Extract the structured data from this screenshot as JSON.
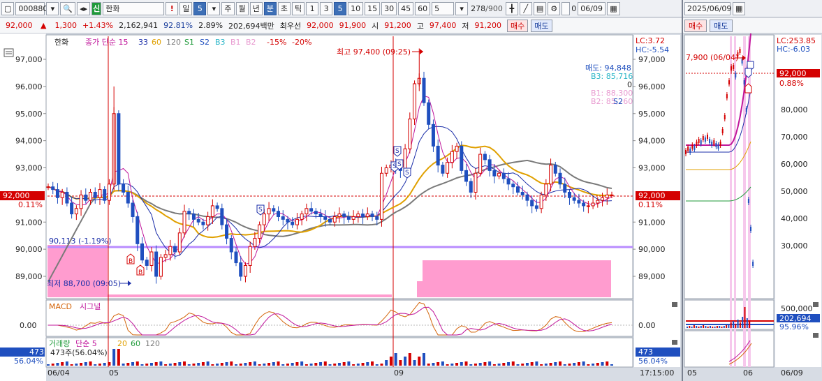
{
  "toolbar": {
    "code": "000880",
    "name": "한화",
    "alert": "!",
    "period_day": "일",
    "period_num": "5",
    "periods": [
      "주",
      "월",
      "년",
      "분",
      "초",
      "틱"
    ],
    "selected_period": "분",
    "minutes": [
      "1",
      "3",
      "5",
      "10",
      "15",
      "30",
      "45",
      "60"
    ],
    "selected_minute": "5",
    "count": "5",
    "bar_count": "278",
    "bar_total": "/900",
    "date": "06/09",
    "checkbox_value": "0"
  },
  "quote": {
    "price": "92,000",
    "arrow": "▲",
    "change": "1,300",
    "change_pct": "+1.43%",
    "volume": "2,162,941",
    "vol_ratio": "92.81%",
    "turnover_pct": "2.89%",
    "amount": "202,694백만",
    "priority_label": "최우선",
    "ask": "92,000",
    "bid": "91,900",
    "open_label": "시",
    "open": "91,200",
    "high_label": "고",
    "high": "97,400",
    "low_label": "저",
    "low": "91,200",
    "buy": "매수",
    "sell": "매도"
  },
  "legend": {
    "name": "한화",
    "price_line": "종가 단순 15",
    "ma33": "33",
    "ma60": "60",
    "ma120": "120",
    "s1": "S1",
    "s2": "S2",
    "b3": "B3",
    "b1": "B1",
    "b2": "B2",
    "minus15": "-15%",
    "minus20": "-20%",
    "lc": "LC:3.72",
    "hc": "HC:-5.54"
  },
  "annotations": {
    "high": "최고 97,400 (09:25)",
    "low": "최저 88,700 (09:05)",
    "base": "90,113 (-1.19%)",
    "sell_level": "매도: 94,848",
    "b3_level": "B3: 85,716",
    "zero": "0",
    "b1_level": "B1: 88,300",
    "b2_level": "B2: 85,260",
    "s2_tag": "S2",
    "cur_price": "92,000",
    "cur_pct": "0.11%"
  },
  "colors": {
    "up": "#d40000",
    "down": "#1f4fbf",
    "ma15": "#c0169b",
    "ma33": "#1b2ea8",
    "ma60": "#e0a000",
    "ma120": "#7a7a7a",
    "pink_zone": "#ff9ccf",
    "base_line": "#b98cff"
  },
  "price_axis": [
    "97,000",
    "96,000",
    "95,000",
    "94,000",
    "93,000",
    "92,000",
    "91,000",
    "90,000",
    "89,000"
  ],
  "macd": {
    "label": "MACD",
    "signal": "시그널",
    "zero": "0.00"
  },
  "volume": {
    "label": "거래량",
    "ma": "단순 5",
    "ma20": "20",
    "ma60": "60",
    "ma120": "120",
    "current": "473주(56.04%)",
    "axis_val": "473",
    "axis_pct": "56.04%"
  },
  "x_axis": {
    "labels": [
      "06/04",
      "05",
      "09"
    ],
    "time": "17:15:00"
  },
  "side": {
    "date": "2025/06/09",
    "buy": "매수",
    "sell": "매도",
    "lc": "LC:253.85",
    "hc": "HC:-6.03",
    "high_note": "7,900 (06/04)",
    "cur_price": "92,000",
    "cur_pct": "0.88%",
    "price_axis": [
      "80,000",
      "70,000",
      "60,000",
      "50,000",
      "40,000",
      "30,000"
    ],
    "vol_axis": "500,000",
    "vol_val": "202,694",
    "vol_pct": "95.96%",
    "x_labels": [
      "05",
      "06",
      "06/09"
    ]
  },
  "chart_data": {
    "type": "candlestick",
    "title": "",
    "ylim": [
      88500,
      97500
    ],
    "reference_lines": {
      "current": 92000,
      "base": 90113,
      "high": 97400,
      "low": 88700
    },
    "close_path": [
      92300,
      92200,
      91900,
      92100,
      91700,
      91300,
      91500,
      92000,
      91800,
      92100,
      91900,
      92200,
      91800,
      92400,
      95000,
      92400,
      92100,
      91700,
      91200,
      90200,
      89600,
      89400,
      89900,
      89000,
      89700,
      89800,
      90100,
      89900,
      90600,
      91400,
      91300,
      91100,
      91000,
      90900,
      91200,
      91600,
      91500,
      90900,
      90400,
      89900,
      89500,
      89000,
      89400,
      90100,
      90400,
      90900,
      91300,
      91500,
      91400,
      91200,
      91100,
      91000,
      90900,
      91100,
      91300,
      91500,
      91400,
      91300,
      91200,
      91100,
      91000,
      91200,
      91300,
      91200,
      91100,
      91200,
      91300,
      91200,
      91300,
      91200,
      91100,
      92800,
      93000,
      93100,
      93000,
      92900,
      93700,
      94800,
      96100,
      96300,
      95400,
      94600,
      93800,
      93100,
      92800,
      93200,
      93600,
      93800,
      92900,
      92500,
      92100,
      92800,
      93500,
      93300,
      92900,
      92700,
      92800,
      92600,
      92400,
      92300,
      92100,
      92000,
      91800,
      91600,
      91500,
      92000,
      92400,
      93100,
      92800,
      92400,
      92100,
      91900,
      91800,
      91700,
      91600,
      91600,
      91700,
      91800,
      91900,
      92000,
      92000
    ]
  }
}
